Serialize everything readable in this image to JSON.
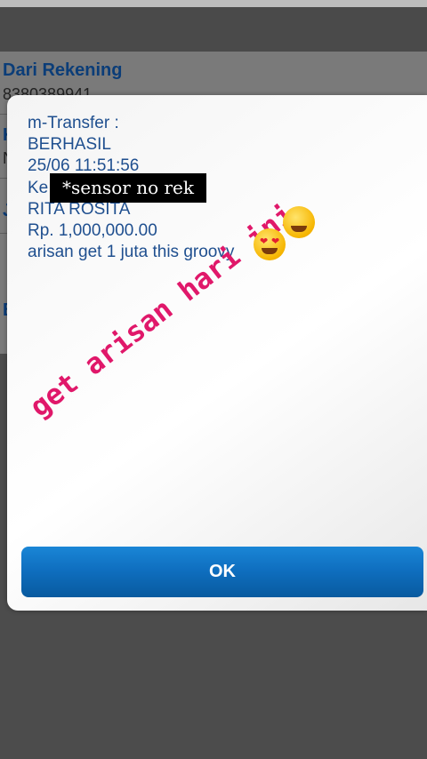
{
  "background": {
    "from_account_label": "Dari Rekening",
    "from_account_value": "8380389941",
    "partial_letters": [
      "K",
      "N",
      "J",
      "B"
    ]
  },
  "dialog": {
    "lines": [
      "m-Transfer :",
      "BERHASIL",
      "25/06 11:51:56",
      "Ke",
      "RITA ROSITA",
      "Rp. 1,000,000.00",
      "arisan get 1 juta this groovy"
    ],
    "censor_text": "*sensor no rek",
    "sticker_text": "get arisan hari ini",
    "emoji_icons": [
      "heart-eyes-emoji-icon",
      "money-mouth-emoji-icon"
    ],
    "ok_label": "OK"
  },
  "colors": {
    "dialog_text": "#1f4f8f",
    "button": "#0f6fc0",
    "sticker": "#e0186a"
  }
}
